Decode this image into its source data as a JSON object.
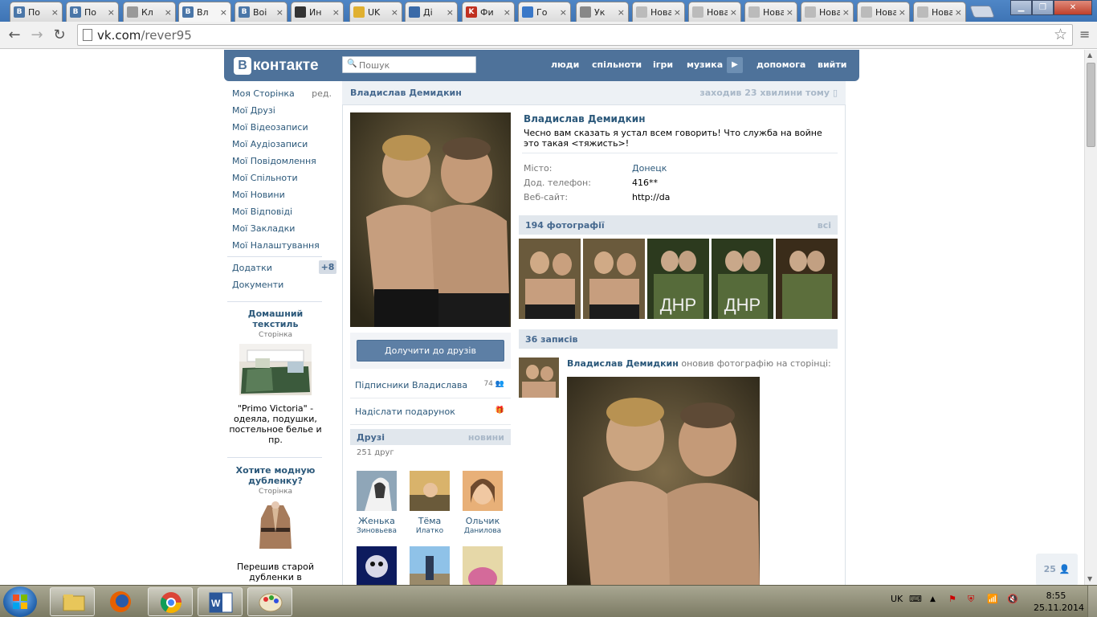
{
  "browser": {
    "tabs": [
      {
        "label": "По",
        "fav": "B"
      },
      {
        "label": "По",
        "fav": "B"
      },
      {
        "label": "Кл",
        "fav": ""
      },
      {
        "label": "Вл",
        "fav": "B"
      },
      {
        "label": "Воі",
        "fav": "B"
      },
      {
        "label": "Ин",
        "fav": ""
      },
      {
        "label": "UK",
        "fav": ""
      },
      {
        "label": "Ді",
        "fav": ""
      },
      {
        "label": "Фи",
        "fav": "K"
      },
      {
        "label": "Го",
        "fav": ""
      },
      {
        "label": "Ук",
        "fav": ""
      },
      {
        "label": "Нова",
        "fav": ""
      },
      {
        "label": "Нова",
        "fav": ""
      },
      {
        "label": "Нова",
        "fav": ""
      },
      {
        "label": "Нова",
        "fav": ""
      },
      {
        "label": "Нова",
        "fav": ""
      },
      {
        "label": "Нова",
        "fav": ""
      }
    ],
    "active_tab": 3,
    "url_host": "vk.com",
    "url_path": "/rever95"
  },
  "vk": {
    "logo_b": "В",
    "logo_text": "контакте",
    "search_placeholder": "Пошук",
    "nav": [
      "люди",
      "спільноти",
      "ігри",
      "музика",
      "допомога",
      "вийти"
    ],
    "menu": [
      "Моя Сторінка",
      "Мої Друзі",
      "Мої Відеозаписи",
      "Мої Аудіозаписи",
      "Мої Повідомлення",
      "Мої Спільноти",
      "Мої Новини",
      "Мої Відповіді",
      "Мої Закладки",
      "Мої Налаштування"
    ],
    "edit_label": "ред.",
    "menu2": [
      "Додатки",
      "Документи"
    ],
    "apps_badge": "+8",
    "ads": [
      {
        "title": "Домашний текстиль",
        "sub": "Сторінка",
        "desc": "\"Primo Victoria\" - одеяла, подушки, постельное белье и пр."
      },
      {
        "title": "Хотите модную дубленку?",
        "sub": "Сторінка",
        "desc": "Перешив старой дубленки в модную,"
      }
    ]
  },
  "profile": {
    "header_name": "Владислав Демидкин",
    "last_seen": "заходив 23 хвилини тому",
    "name": "Владислав Демидкин",
    "status": "Чесно вам сказать я устал всем говорить! Что служба на войне это такая <тяжисть>!",
    "info": [
      {
        "label": "Місто:",
        "value": "Донецк"
      },
      {
        "label": "Дод. телефон:",
        "value": "416**"
      },
      {
        "label": "Веб-сайт:",
        "value": "http://da"
      }
    ],
    "add_friend": "Долучити до друзів",
    "followers_label": "Підписники Владислава",
    "followers_count": "74",
    "gift_label": "Надіслати подарунок",
    "friends_title": "Друзі",
    "friends_news": "новини",
    "friends_count": "251 друг",
    "friends": [
      {
        "first": "Женька",
        "last": "Зиновьева"
      },
      {
        "first": "Тёма",
        "last": "Илатко"
      },
      {
        "first": "Ольчик",
        "last": "Данилова"
      }
    ],
    "photos_title": "194 фотографії",
    "photos_all": "всі",
    "photo_captions": [
      "",
      "",
      "ДНР",
      "ДНР",
      ""
    ],
    "posts_title": "36 записів",
    "post_author": "Владислав Демидкин",
    "post_action": "оновив фотографію на сторінці:",
    "online_count": "25"
  },
  "taskbar": {
    "lang": "UK",
    "time": "8:55",
    "date": "25.11.2014"
  }
}
